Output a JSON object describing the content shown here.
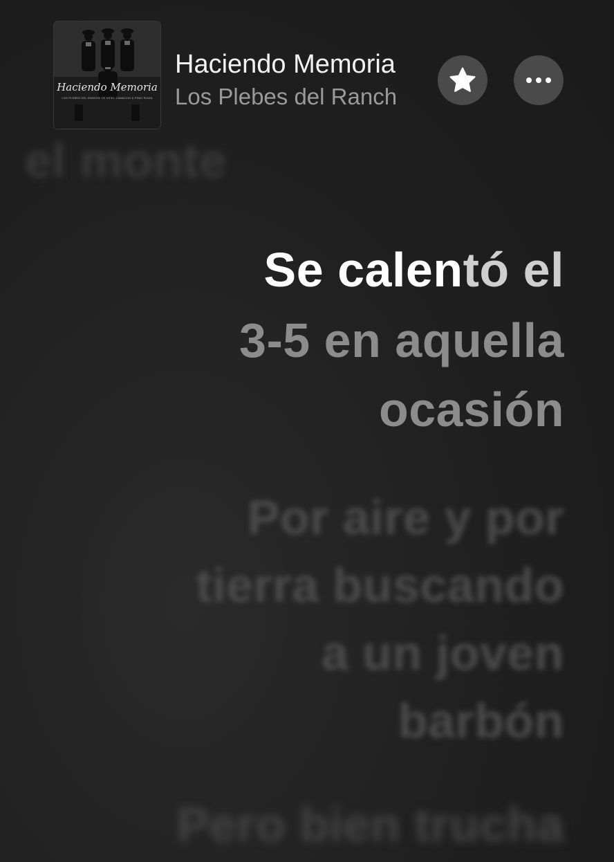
{
  "now_playing": {
    "title": "Haciendo Memoria",
    "artist": "Los Plebes del Ranch",
    "artwork": {
      "script_title": "Haciendo Memoria",
      "credits": "LOS PLEBES DEL RANCHO DE ARIEL CAMACHO & PINKI RUIZA"
    },
    "favorite_icon": "star-icon",
    "more_icon": "ellipsis-icon"
  },
  "lyrics": {
    "previous": "el monte",
    "current": {
      "line1_sung": "Se calen",
      "line1_rest": "tó el",
      "line2": "3-5 en aquella",
      "line3": "ocasión"
    },
    "upcoming": [
      "Por aire y por",
      "tierra buscando",
      "a un joven",
      "barbón",
      "Pero bien trucha"
    ]
  }
}
